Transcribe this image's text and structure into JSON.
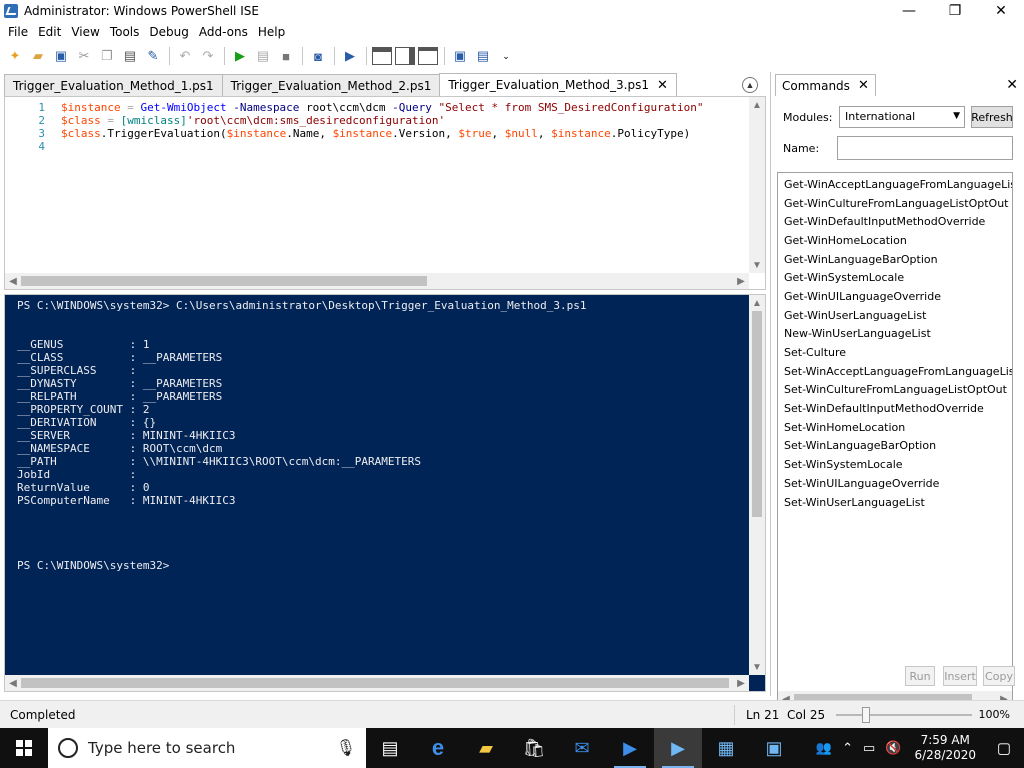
{
  "window": {
    "title": "Administrator: Windows PowerShell ISE",
    "minimize": "—",
    "restore": "❐",
    "close": "✕"
  },
  "menu": [
    "File",
    "Edit",
    "View",
    "Tools",
    "Debug",
    "Add-ons",
    "Help"
  ],
  "tabs": [
    {
      "label": "Trigger_Evaluation_Method_1.ps1",
      "active": false
    },
    {
      "label": "Trigger_Evaluation_Method_2.ps1",
      "active": false
    },
    {
      "label": "Trigger_Evaluation_Method_3.ps1",
      "active": true
    }
  ],
  "tab_close": "✕",
  "editor": {
    "line_numbers": "1\n2\n3\n4"
  },
  "console": {
    "prompt_line": "PS C:\\WINDOWS\\system32> C:\\Users\\administrator\\Desktop\\Trigger_Evaluation_Method_3.ps1",
    "output": "__GENUS          : 1\n__CLASS          : __PARAMETERS\n__SUPERCLASS     :\n__DYNASTY        : __PARAMETERS\n__RELPATH        : __PARAMETERS\n__PROPERTY_COUNT : 2\n__DERIVATION     : {}\n__SERVER         : MININT-4HKIIC3\n__NAMESPACE      : ROOT\\ccm\\dcm\n__PATH           : \\\\MININT-4HKIIC3\\ROOT\\ccm\\dcm:__PARAMETERS\nJobId            :\nReturnValue      : 0\nPSComputerName   : MININT-4HKIIC3",
    "final_prompt": "PS C:\\WINDOWS\\system32>"
  },
  "commands": {
    "tab_label": "Commands",
    "modules_label": "Modules:",
    "modules_value": "International",
    "refresh_label": "Refresh",
    "name_label": "Name:",
    "items": [
      "Get-WinAcceptLanguageFromLanguageListOpt",
      "Get-WinCultureFromLanguageListOptOut",
      "Get-WinDefaultInputMethodOverride",
      "Get-WinHomeLocation",
      "Get-WinLanguageBarOption",
      "Get-WinSystemLocale",
      "Get-WinUILanguageOverride",
      "Get-WinUserLanguageList",
      "New-WinUserLanguageList",
      "Set-Culture",
      "Set-WinAcceptLanguageFromLanguageListOpt",
      "Set-WinCultureFromLanguageListOptOut",
      "Set-WinDefaultInputMethodOverride",
      "Set-WinHomeLocation",
      "Set-WinLanguageBarOption",
      "Set-WinSystemLocale",
      "Set-WinUILanguageOverride",
      "Set-WinUserLanguageList"
    ],
    "run_label": "Run",
    "insert_label": "Insert",
    "copy_label": "Copy"
  },
  "status": {
    "text": "Completed",
    "position": "Ln 21  Col 25",
    "zoom": "100%",
    "zoom_level": 0.22
  },
  "taskbar": {
    "search_placeholder": "Type here to search",
    "time": "7:59 AM",
    "date": "6/28/2020"
  },
  "colors": {
    "console_bg": "#012456",
    "console_fg": "#eeedf0",
    "taskbar_bg": "#101010"
  }
}
